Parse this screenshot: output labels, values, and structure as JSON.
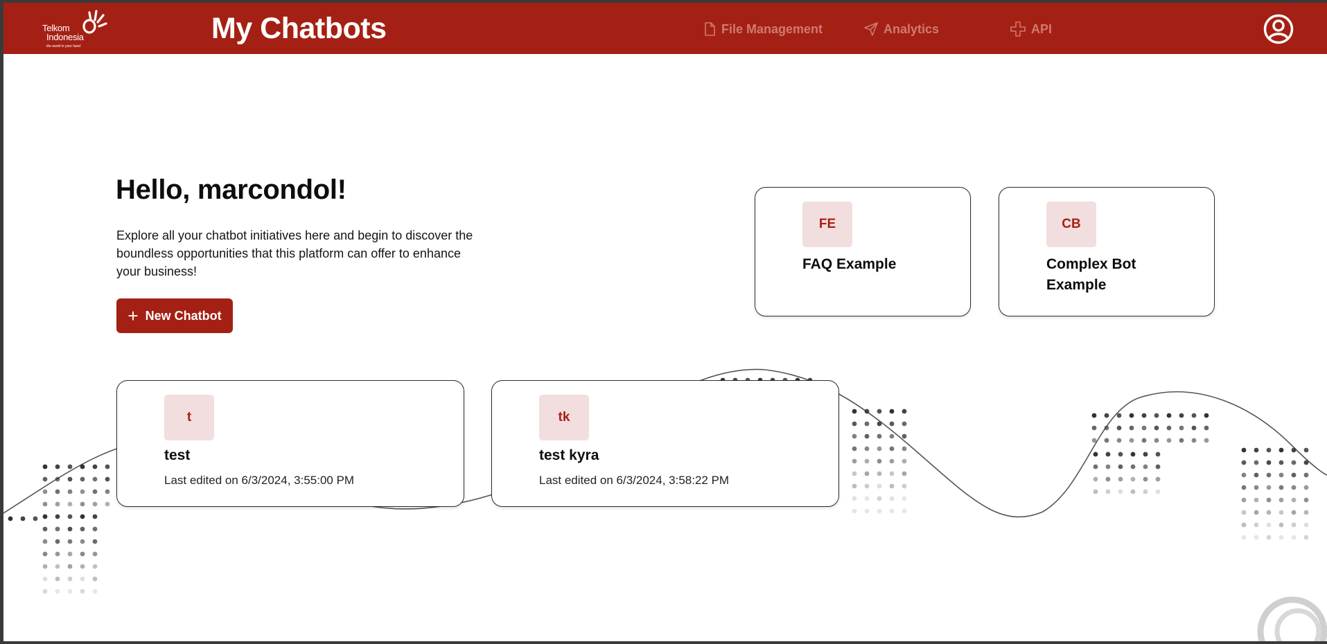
{
  "header": {
    "logo": {
      "line1": "Telkom",
      "line2": "Indonesia",
      "tagline": "the world in your hand"
    },
    "title": "My Chatbots",
    "nav": [
      {
        "label": "File Management",
        "icon": "file-icon"
      },
      {
        "label": "Analytics",
        "icon": "send-icon"
      },
      {
        "label": "API",
        "icon": "plus-cross-icon"
      }
    ],
    "profile_icon": "user-circle-icon"
  },
  "hero": {
    "greeting": "Hello, marcondol!",
    "intro": "Explore all your chatbot initiatives here and begin to discover the boundless opportunities that this platform can offer to enhance your business!",
    "new_button_label": "New Chatbot",
    "new_button_icon": "+"
  },
  "templates": [
    {
      "initials": "FE",
      "title": "FAQ Example"
    },
    {
      "initials": "CB",
      "title": "Complex Bot Example"
    }
  ],
  "chatbots": [
    {
      "initials": "t",
      "name": "test",
      "edited": "Last edited on 6/3/2024, 3:55:00 PM"
    },
    {
      "initials": "tk",
      "name": "test kyra",
      "edited": "Last edited on 6/3/2024, 3:58:22 PM"
    }
  ],
  "colors": {
    "brand": "#a52014",
    "badge_bg": "#f2dede",
    "nav_muted": "#cf7a70"
  }
}
